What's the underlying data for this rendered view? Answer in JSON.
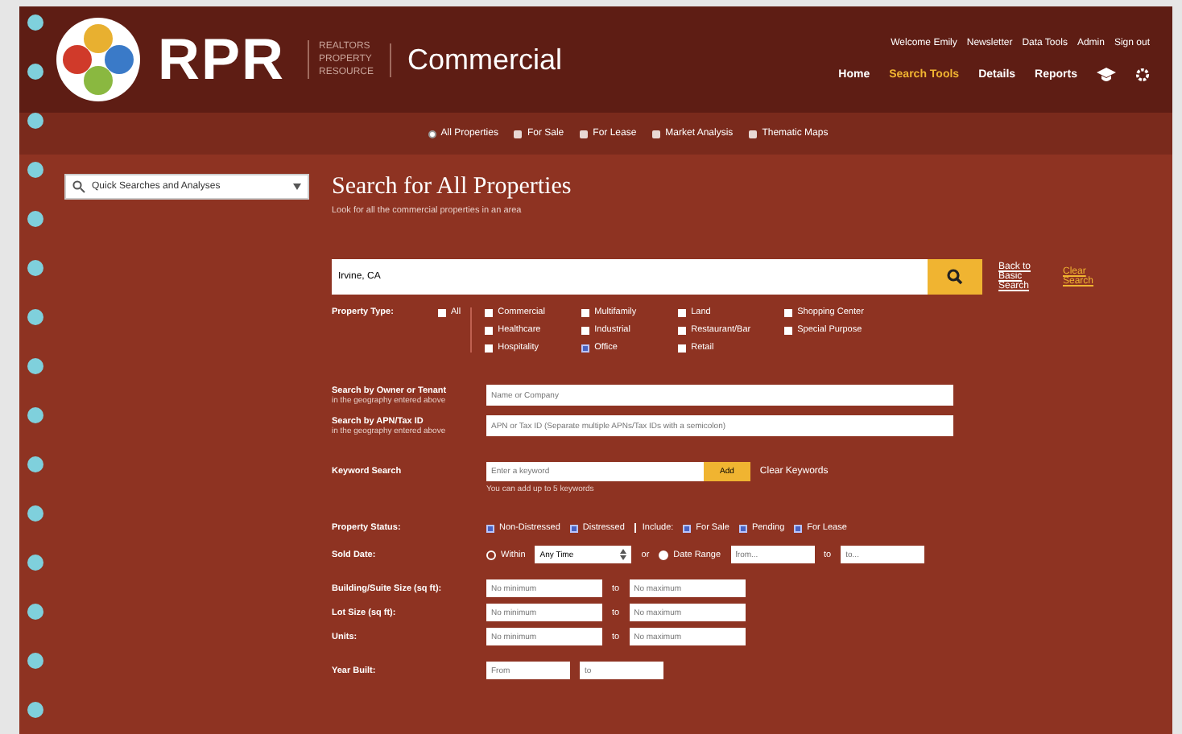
{
  "header": {
    "logo_text": "RPR",
    "logo_sub": [
      "REALTORS",
      "PROPERTY",
      "RESOURCE"
    ],
    "product": "Commercial",
    "util_links": [
      "Welcome Emily",
      "Newsletter",
      "Data Tools",
      "Admin",
      "Sign out"
    ],
    "nav": [
      {
        "label": "Home",
        "selected": false
      },
      {
        "label": "Search Tools",
        "selected": true
      },
      {
        "label": "Details",
        "selected": false
      },
      {
        "label": "Reports",
        "selected": false
      }
    ]
  },
  "subnav": [
    {
      "label": "All Properties",
      "selected": true
    },
    {
      "label": "For Sale",
      "selected": false
    },
    {
      "label": "For Lease",
      "selected": false
    },
    {
      "label": "Market Analysis",
      "selected": false
    },
    {
      "label": "Thematic Maps",
      "selected": false
    }
  ],
  "sidebar": {
    "dropdown": "Quick Searches and Analyses"
  },
  "title": "Search for All Properties",
  "subtitle": "Look for all the commercial properties in an area",
  "search": {
    "value": "Irvine, CA",
    "links": [
      "Back to Basic Search",
      "Clear Search"
    ]
  },
  "property_type": {
    "label": "Property Type:",
    "all": {
      "label": "All",
      "checked": false
    },
    "columns": [
      [
        {
          "label": "Commercial",
          "checked": false
        },
        {
          "label": "Healthcare",
          "checked": false
        },
        {
          "label": "Hospitality",
          "checked": false
        }
      ],
      [
        {
          "label": "Multifamily",
          "checked": false
        },
        {
          "label": "Industrial",
          "checked": false
        },
        {
          "label": "Office",
          "checked": true
        }
      ],
      [
        {
          "label": "Land",
          "checked": false
        },
        {
          "label": "Restaurant/Bar",
          "checked": false
        },
        {
          "label": "Retail",
          "checked": false
        }
      ],
      [
        {
          "label": "Shopping Center",
          "checked": false
        },
        {
          "label": "Special Purpose",
          "checked": false
        }
      ]
    ]
  },
  "text_searches": [
    {
      "label": "Search by Owner or Tenant",
      "hint": "in the geography entered above",
      "placeholder": "Name or Company"
    },
    {
      "label": "Search by APN/Tax ID",
      "hint": "in the geography entered above",
      "placeholder": "APN or Tax ID (Separate multiple APNs/Tax IDs with a semicolon)"
    }
  ],
  "keyword": {
    "label": "Keyword Search",
    "placeholder": "Enter a keyword",
    "button": "Add",
    "clear": "Clear Keywords",
    "note": "You can add up to 5 keywords"
  },
  "status": {
    "label": "Property Status:",
    "options": [
      {
        "label": "Non-Distressed",
        "checked": true
      },
      {
        "label": "Distressed",
        "checked": true
      }
    ],
    "include_label": "Include:",
    "include": [
      {
        "label": "For Sale",
        "checked": true
      },
      {
        "label": "Pending",
        "checked": true
      },
      {
        "label": "For Lease",
        "checked": true
      }
    ]
  },
  "sold_date": {
    "label": "Sold Date:",
    "within": {
      "label": "Within",
      "selected": false
    },
    "period": "Any Time",
    "or": "or",
    "range": {
      "label": "Date Range",
      "selected": true
    },
    "from": {
      "placeholder": "from..."
    },
    "to_label": "to",
    "to": {
      "placeholder": "to..."
    }
  },
  "ranges": [
    {
      "label": "Building/Suite Size (sq ft):",
      "min": {
        "placeholder": "No minimum"
      },
      "to": "to",
      "max": {
        "placeholder": "No maximum"
      }
    },
    {
      "label": "Lot Size (sq ft):",
      "min": {
        "placeholder": "No minimum"
      },
      "to": "to",
      "max": {
        "placeholder": "No maximum"
      }
    },
    {
      "label": "Units:",
      "min": {
        "placeholder": "No minimum"
      },
      "to": "to",
      "max": {
        "placeholder": "No maximum"
      }
    }
  ],
  "year_built": {
    "label": "Year Built:",
    "from": {
      "placeholder": "From"
    },
    "to": {
      "placeholder": "to"
    }
  }
}
